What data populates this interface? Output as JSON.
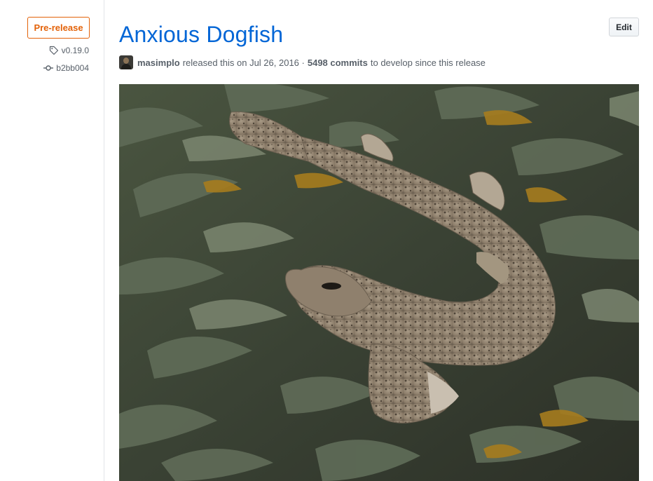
{
  "sidebar": {
    "badge": "Pre-release",
    "tag": "v0.19.0",
    "commit": "b2bb004"
  },
  "release": {
    "title": "Anxious Dogfish",
    "edit_label": "Edit",
    "author": "masimplo",
    "released_text": "released this on Jul 26, 2016 ·",
    "commits_count": "5498 commits",
    "commits_suffix": "to develop since this release"
  },
  "icons": {
    "tag": "tag-icon",
    "commit": "git-commit-icon",
    "avatar": "user-avatar"
  },
  "colors": {
    "title": "#0366d6",
    "prerelease": "#e36209",
    "muted": "#586069"
  }
}
